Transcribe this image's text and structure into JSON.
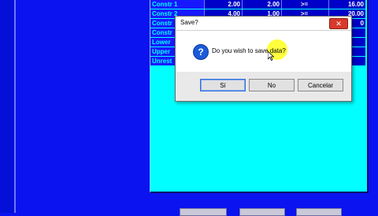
{
  "rows": [
    {
      "label": "Constr 1",
      "v1": "2.00",
      "v2": "2.00",
      "op": ">=",
      "rhs": "16.00"
    },
    {
      "label": "Constr 2",
      "v1": "4.00",
      "v2": "1.00",
      "op": ">=",
      "rhs": "20.00"
    },
    {
      "label": "Constr",
      "v1": "",
      "v2": "",
      "op": "",
      "rhs": "0"
    },
    {
      "label": "Constr",
      "v1": "",
      "v2": "",
      "op": "",
      "rhs": ""
    },
    {
      "label": "Lower",
      "v1": "",
      "v2": "",
      "op": "",
      "rhs": ""
    },
    {
      "label": "Upper",
      "v1": "",
      "v2": "",
      "op": "",
      "rhs": ""
    },
    {
      "label": "Unrest",
      "v1": "",
      "v2": "",
      "op": "",
      "rhs": ""
    }
  ],
  "dialog": {
    "title": "Save?",
    "close_glyph": "✕",
    "message": "Do you wish to save data?",
    "icon_glyph": "?",
    "buttons": {
      "yes": "Sí",
      "no": "No",
      "cancel": "Cancelar"
    }
  },
  "colors": {
    "background": "#0b13f0",
    "panel": "#00ffff",
    "highlight": "#ffff33"
  },
  "icons": {
    "question": "question-icon",
    "cursor": "mouse-cursor-icon",
    "close": "close-icon"
  }
}
